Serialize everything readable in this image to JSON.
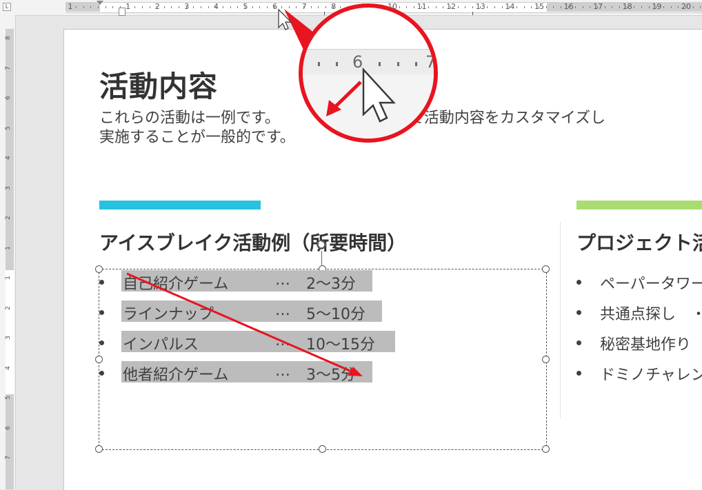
{
  "ruler": {
    "corner_label": "L",
    "numbers": [
      "1",
      "1",
      "2",
      "3",
      "4",
      "5",
      "6",
      "7",
      "8",
      "9",
      "10",
      "11",
      "12",
      "13",
      "14",
      "15",
      "16",
      "17",
      "18",
      "19",
      "20"
    ],
    "vertical_numbers": [
      "8",
      "7",
      "6",
      "5",
      "4",
      "3",
      "2",
      "1",
      "1",
      "2",
      "3",
      "4",
      "5",
      "6",
      "7"
    ]
  },
  "slide": {
    "title": "活動内容",
    "subtitle_line1": "これらの活動は一例です。　　　　　　に応じて活動内容をカスタマイズし",
    "subtitle_line2": "実施することが一般的です。",
    "left_column": {
      "heading": "アイスブレイク活動例（所要時間）",
      "items": [
        {
          "name": "自己紹介ゲーム",
          "dots": "…",
          "time": "2～3分"
        },
        {
          "name": "ラインナップ",
          "dots": "…",
          "time": "5～10分"
        },
        {
          "name": "インパルス",
          "dots": "…",
          "time": "10～15分"
        },
        {
          "name": "他者紹介ゲーム",
          "dots": "…",
          "time": "3～5分"
        }
      ]
    },
    "right_column": {
      "heading": "プロジェクト活",
      "items": [
        "ペーパータワー",
        "共通点探し　・",
        "秘密基地作り",
        "ドミノチャレンジ"
      ]
    }
  },
  "magnifier": {
    "num_left": "6",
    "num_right": "7"
  },
  "colors": {
    "accent_blue": "#27c2e0",
    "accent_green": "#a9dd70",
    "annotation_red": "#e8141f",
    "selection_highlight": "#bcbcbc"
  }
}
